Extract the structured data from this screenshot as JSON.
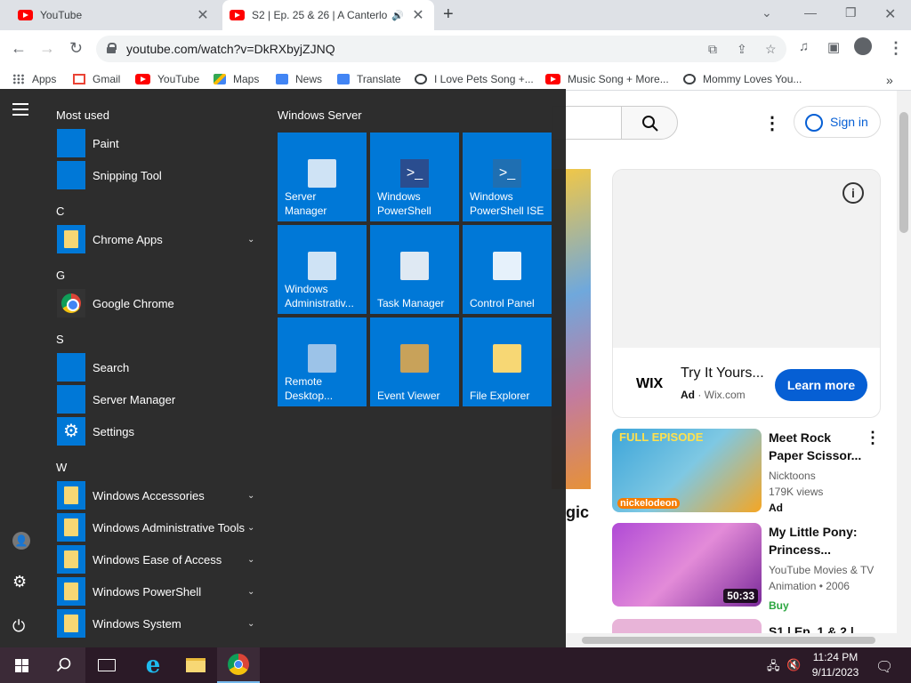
{
  "browser": {
    "tabs": [
      {
        "title": "YouTube",
        "active": false
      },
      {
        "title": "S2 | Ep. 25 & 26 | A Canterlo",
        "active": true
      }
    ],
    "url": "youtube.com/watch?v=DkRXbyjZJNQ",
    "bookmarks": [
      "Apps",
      "Gmail",
      "YouTube",
      "Maps",
      "News",
      "Translate",
      "I Love Pets Song +...",
      "Music Song + More...",
      "Mommy Loves You..."
    ],
    "more_bookmarks": "»"
  },
  "youtube": {
    "sign_in": "Sign in",
    "video_title_fragment": "gic",
    "ad": {
      "brand": "WIX",
      "title": "Try It Yours...",
      "ad_label": "Ad",
      "domain": "Wix.com",
      "cta": "Learn more"
    },
    "recommendations": [
      {
        "title": "Meet Rock Paper Scissor...",
        "channel": "Nicktoons",
        "meta": "179K views",
        "badge": "Ad",
        "duration": ""
      },
      {
        "title": "My Little Pony: Princess...",
        "channel": "YouTube Movies & TV",
        "meta": "Animation • 2006",
        "badge": "Buy",
        "duration": "50:33"
      },
      {
        "title": "S1 | Ep. 1 & 2 |",
        "channel": "",
        "meta": "",
        "badge": "",
        "duration": ""
      }
    ],
    "thumb1_text": {
      "top": "FULL EPISODE",
      "brand": "nickelodeon"
    }
  },
  "start_menu": {
    "most_used_label": "Most used",
    "most_used": [
      "Paint",
      "Snipping Tool"
    ],
    "groups": [
      {
        "letter": "C",
        "apps": [
          {
            "name": "Chrome Apps",
            "expandable": true
          }
        ]
      },
      {
        "letter": "G",
        "apps": [
          {
            "name": "Google Chrome",
            "expandable": false
          }
        ]
      },
      {
        "letter": "S",
        "apps": [
          {
            "name": "Search",
            "expandable": false
          },
          {
            "name": "Server Manager",
            "expandable": false
          },
          {
            "name": "Settings",
            "expandable": false
          }
        ]
      },
      {
        "letter": "W",
        "apps": [
          {
            "name": "Windows Accessories",
            "expandable": true
          },
          {
            "name": "Windows Administrative Tools",
            "expandable": true
          },
          {
            "name": "Windows Ease of Access",
            "expandable": true
          },
          {
            "name": "Windows PowerShell",
            "expandable": true
          },
          {
            "name": "Windows System",
            "expandable": true
          }
        ]
      }
    ],
    "tiles_header": "Windows Server",
    "tiles": [
      "Server Manager",
      "Windows PowerShell",
      "Windows PowerShell ISE",
      "Windows Administrativ...",
      "Task Manager",
      "Control Panel",
      "Remote Desktop...",
      "Event Viewer",
      "File Explorer"
    ]
  },
  "taskbar": {
    "time": "11:24 PM",
    "date": "9/11/2023"
  },
  "colors": {
    "accent": "#0078d7",
    "youtube_red": "#ff0000",
    "link_blue": "#065fd4"
  }
}
